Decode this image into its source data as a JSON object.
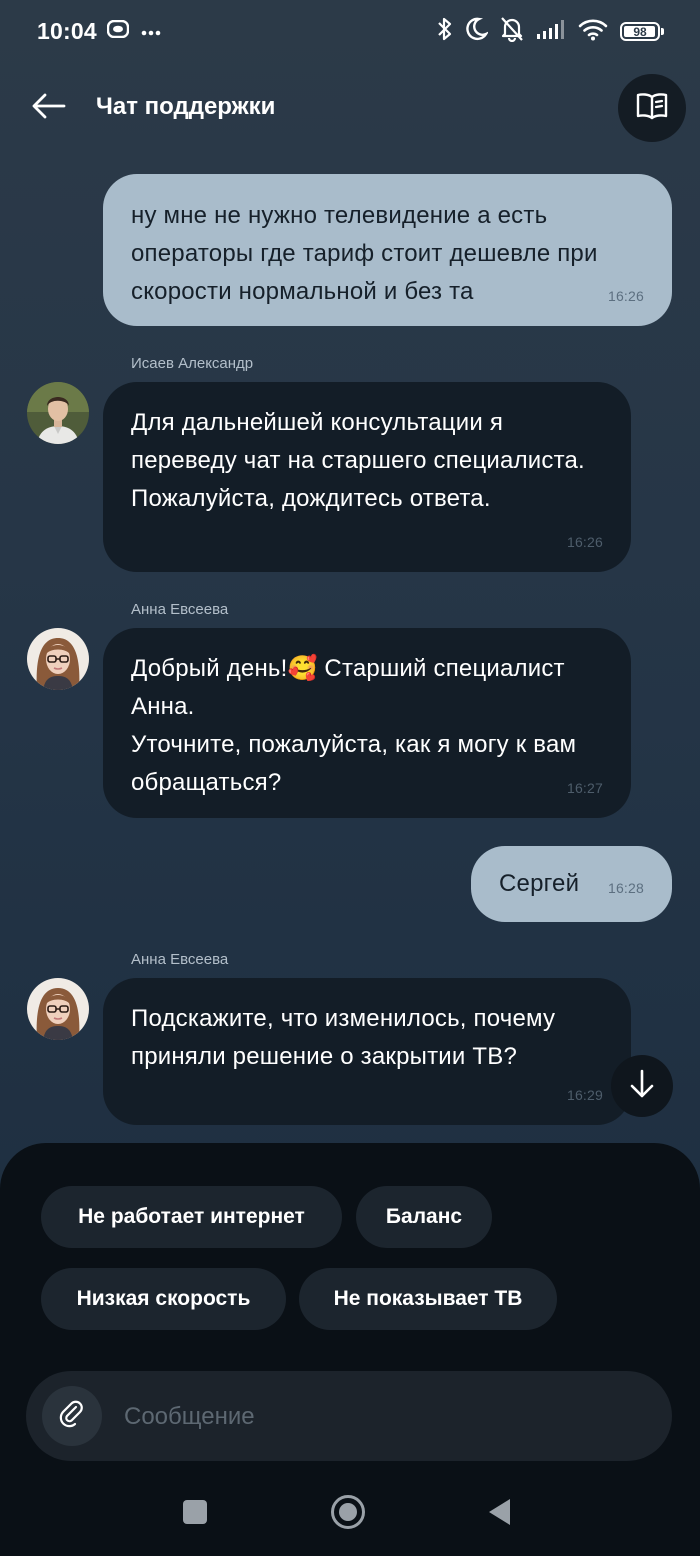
{
  "status_bar": {
    "time": "10:04",
    "battery": "98",
    "battery_level": 0.98,
    "icons": [
      "bluetooth-icon",
      "moon-icon",
      "bell-off-icon",
      "signal-icon",
      "wifi-icon",
      "battery-icon"
    ]
  },
  "header": {
    "title": "Чат поддержки",
    "back_icon": "arrow-left-icon",
    "book_icon": "book-icon"
  },
  "messages": [
    {
      "direction": "out",
      "text": "ну мне не нужно телевидение а есть операторы где тариф стоит дешевле при скорости нормальной и без та",
      "time": "16:26"
    },
    {
      "direction": "in",
      "sender": "Исаев Александр",
      "text": "Для дальнейшей консультации я переведу чат на старшего специалиста. Пожалуйста, дождитесь ответа.",
      "time": "16:26"
    },
    {
      "direction": "in",
      "sender": "Анна Евсеева",
      "text": "Добрый день!🥰 Старший специалист Анна.\nУточните, пожалуйста, как я могу к вам обращаться?",
      "time": "16:27"
    },
    {
      "direction": "out",
      "text": "Сергей",
      "time": "16:28"
    },
    {
      "direction": "in",
      "sender": "Анна Евсеева",
      "text": "Подскажите, что изменилось, почему приняли решение о закрытии ТВ?",
      "time": "16:29"
    }
  ],
  "quick_replies": [
    "Не работает интернет",
    "Баланс",
    "Низкая скорость",
    "Не показывает ТВ"
  ],
  "composer": {
    "placeholder": "Сообщение",
    "attach_icon": "paperclip-icon"
  },
  "colors": {
    "outgoing_bubble": "#a9bccb",
    "incoming_bubble": "#131d27",
    "bottom_sheet": "#0a1016",
    "chip": "#1c252e"
  }
}
